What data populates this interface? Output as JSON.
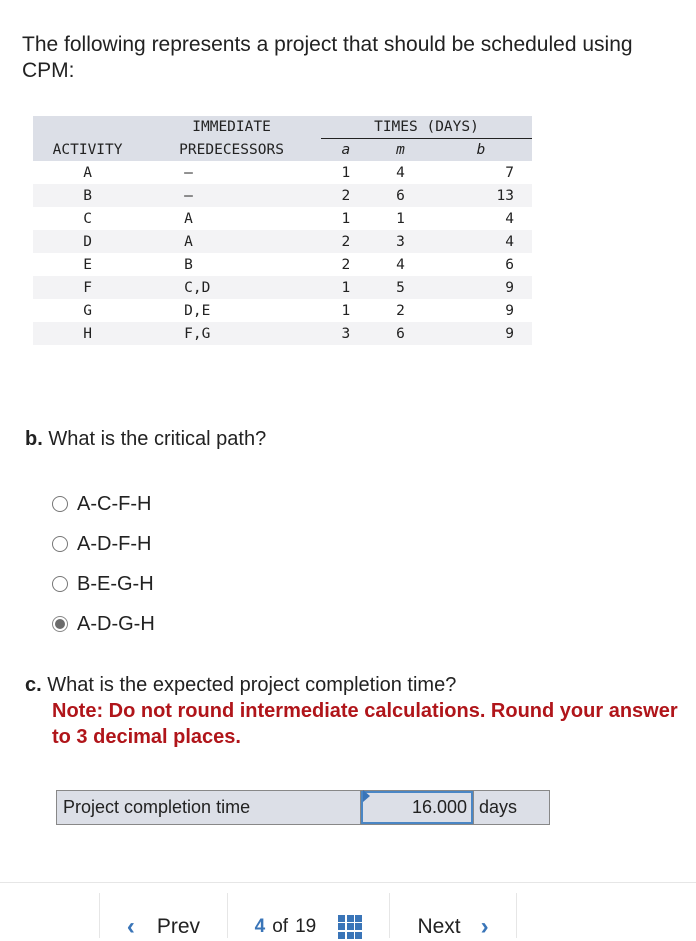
{
  "intro": "The following represents a project that should be scheduled using CPM:",
  "table": {
    "headers": {
      "activity": "ACTIVITY",
      "pred_line1": "IMMEDIATE",
      "pred_line2": "PREDECESSORS",
      "times": "TIMES (DAYS)",
      "a": "a",
      "m": "m",
      "b": "b"
    },
    "rows": [
      {
        "activity": "A",
        "pred": "–",
        "a": "1",
        "m": "4",
        "b": "7"
      },
      {
        "activity": "B",
        "pred": "–",
        "a": "2",
        "m": "6",
        "b": "13"
      },
      {
        "activity": "C",
        "pred": "A",
        "a": "1",
        "m": "1",
        "b": "4"
      },
      {
        "activity": "D",
        "pred": "A",
        "a": "2",
        "m": "3",
        "b": "4"
      },
      {
        "activity": "E",
        "pred": "B",
        "a": "2",
        "m": "4",
        "b": "6"
      },
      {
        "activity": "F",
        "pred": "C,D",
        "a": "1",
        "m": "5",
        "b": "9"
      },
      {
        "activity": "G",
        "pred": "D,E",
        "a": "1",
        "m": "2",
        "b": "9"
      },
      {
        "activity": "H",
        "pred": "F,G",
        "a": "3",
        "m": "6",
        "b": "9"
      }
    ]
  },
  "question_b": {
    "label": "b.",
    "text": "What is the critical path?",
    "options": [
      {
        "label": "A-C-F-H",
        "selected": false
      },
      {
        "label": "A-D-F-H",
        "selected": false
      },
      {
        "label": "B-E-G-H",
        "selected": false
      },
      {
        "label": "A-D-G-H",
        "selected": true
      }
    ]
  },
  "question_c": {
    "label": "c.",
    "text": "What is the expected project completion time?",
    "note": "Note: Do not round intermediate calculations. Round your answer to 3 decimal places.",
    "answer_label": "Project completion time",
    "answer_value": "16.000",
    "answer_unit": "days"
  },
  "nav": {
    "prev": "Prev",
    "current": "4",
    "of": "of",
    "total": "19",
    "next": "Next",
    "prev_icon": "chevron-left-icon",
    "next_icon": "chevron-right-icon",
    "grid_icon": "grid-icon"
  },
  "colors": {
    "accent": "#3a75b8",
    "note_red": "#b0151a",
    "header_bg": "#dcdfe7"
  }
}
